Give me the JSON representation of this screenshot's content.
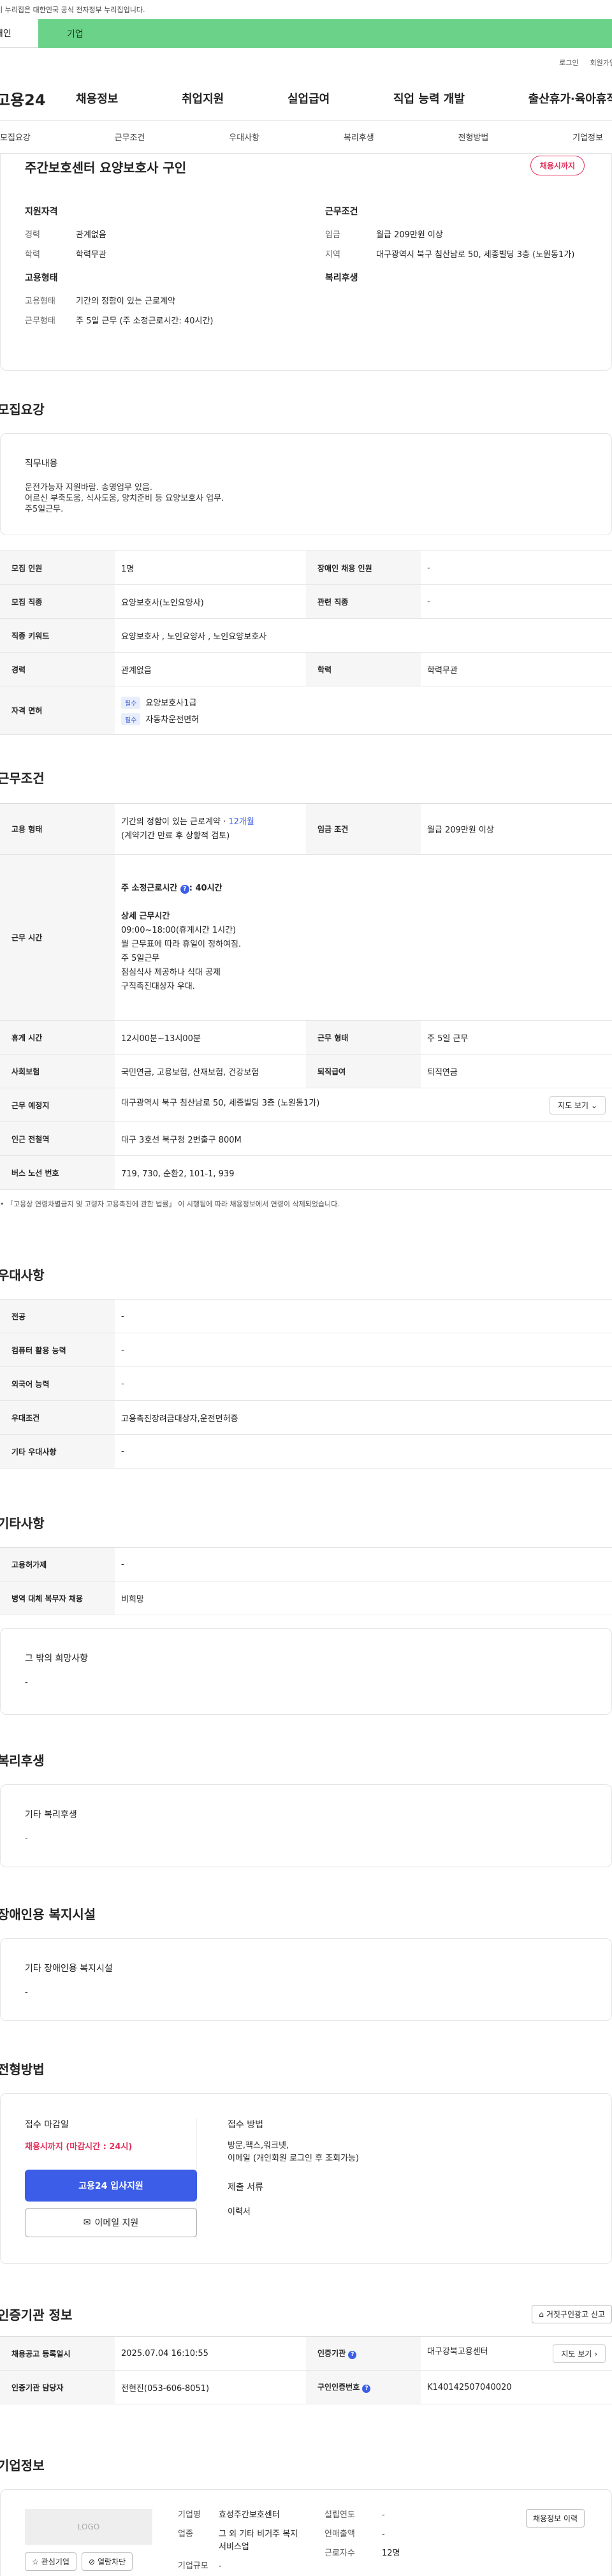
{
  "gov_bar": {
    "text": "이 누리집은 대한민국 공식 전자정부 누리집입니다."
  },
  "tabs": {
    "person": "개인",
    "business": "기업"
  },
  "util": {
    "login": "로그인",
    "join": "회원가입"
  },
  "gnb": {
    "logo": "고용24",
    "menu": [
      "채용정보",
      "취업지원",
      "실업급여",
      "직업 능력 개발",
      "출산휴가·육아휴직"
    ]
  },
  "subnav": [
    "모집요강",
    "근무조건",
    "우대사항",
    "복리후생",
    "전형방법",
    "기업정보"
  ],
  "summary": {
    "title": "주간보호센터 요양보호사 구인",
    "status": "채용시까지",
    "qualification_title": "지원자격",
    "qualification": [
      {
        "k": "경력",
        "v": "관계없음"
      },
      {
        "k": "학력",
        "v": "학력무관"
      }
    ],
    "condition_title": "근무조건",
    "condition": [
      {
        "k": "임금",
        "v": "월급 209만원 이상"
      },
      {
        "k": "지역",
        "v": "대구광역시 북구 침산남로 50, 세종빌딩 3층 (노원동1가)"
      }
    ],
    "employment_title": "고용형태",
    "employment": [
      {
        "k": "고용형태",
        "v": "기간의 정함이 있는 근로계약"
      },
      {
        "k": "근무형태",
        "v": "주 5일 근무 (주 소정근로시간: 40시간)"
      }
    ],
    "welfare_title": "복리후생"
  },
  "recruit": {
    "section_title": "모집요강",
    "job_desc_title": "직무내용",
    "job_desc": [
      "운전가능자 지원바람. 송영업무 있음.",
      "어르신 부축도움, 식사도움, 양치준비 등 요양보호사 업무.",
      "주5일근무."
    ],
    "table": {
      "headcount_label": "모집 인원",
      "headcount": "1명",
      "disabled_label": "장애인 채용 인원",
      "disabled": "-",
      "job_label": "모집 직종",
      "job": "요양보호사(노인요양사)",
      "related_label": "관련 직종",
      "related": "-",
      "keyword_label": "직종 키워드",
      "keyword": "요양보호사 , 노인요양사 , 노인요양보호사",
      "career_label": "경력",
      "career": "관계없음",
      "edu_label": "학력",
      "edu": "학력무관",
      "license_label": "자격 면허",
      "licenses": [
        {
          "tag": "필수",
          "name": "요양보호사1급"
        },
        {
          "tag": "필수",
          "name": "자동차운전면허"
        }
      ]
    }
  },
  "conditions": {
    "section_title": "근무조건",
    "emp_type_label": "고용 형태",
    "emp_type_1": "기간의 정함이 있는 근로계약 · ",
    "emp_type_months": "12개월",
    "emp_type_2": "(계약기간 만료 후 상황적 검토)",
    "wage_label": "임금 조건",
    "wage": "월급 209만원 이상",
    "hours_label": "근무 시간",
    "hours_weekly": "주 소정근로시간",
    "hours_weekly_value": ": 40시간",
    "hours_detail_title": "상세 근무시간",
    "hours_detail": [
      "09:00~18:00(휴게시간 1시간)",
      "월 근무표에 따라 휴일이 정하여짐.",
      "주 5일근무",
      "점심식사 제공하나  식대 공제",
      "구직촉진대상자 우대."
    ],
    "break_label": "휴게 시간",
    "break": "12시00분~13시00분",
    "work_type_label": "근무 형태",
    "work_type": "주 5일 근무",
    "insurance_label": "사회보험",
    "insurance": "국민연금, 고용보험, 산재보험, 건강보험",
    "severance_label": "퇴직급여",
    "severance": "퇴직연금",
    "place_label": "근무 예정지",
    "place": "대구광역시 북구 침산남로 50, 세종빌딩 3층 (노원동1가)",
    "map_btn": "지도 보기",
    "subway_label": "인근 전철역",
    "subway": "대구 3호선 북구청 2번출구 800M",
    "bus_label": "버스 노선 번호",
    "bus": "719, 730, 순환2, 101-1, 939",
    "note": "「고용상 연령차별금지 및 고령자 고용촉진에 관한 법률」 이 시행됨에 따라 채용정보에서 연령이 삭제되었습니다."
  },
  "preference": {
    "section_title": "우대사항",
    "rows": [
      {
        "k": "전공",
        "v": "-"
      },
      {
        "k": "컴퓨터 활용 능력",
        "v": "-"
      },
      {
        "k": "외국어 능력",
        "v": "-"
      },
      {
        "k": "우대조건",
        "v": "고용촉진장려금대상자,운전면허증"
      },
      {
        "k": "기타 우대사항",
        "v": "-"
      }
    ]
  },
  "etc": {
    "section_title": "기타사항",
    "rows": [
      {
        "k": "고용허가제",
        "v": "-"
      },
      {
        "k": "병역 대체 복무자 채용",
        "v": "비희망"
      }
    ],
    "other_title": "그 밖의 희망사항",
    "other_value": "-"
  },
  "welfare": {
    "section_title": "복리후생",
    "card_title": "기타 복리후생",
    "card_value": "-"
  },
  "disabled_facility": {
    "section_title": "장애인용 복지시설",
    "card_title": "기타 장애인용 복지시설",
    "card_value": "-"
  },
  "selection": {
    "section_title": "전형방법",
    "deadline_title": "접수 마감일",
    "deadline_value": "채용시까지 (마감시간 : 24시)",
    "apply_btn": "고용24 입사지원",
    "email_btn": "이메일 지원",
    "method_title": "접수 방법",
    "method_lines": [
      "방문,팩스,워크넷,",
      "이메일 (개인회원 로그인 후 조회가능)"
    ],
    "docs_title": "제출 서류",
    "docs_value": "이력서"
  },
  "cert": {
    "section_title": "인증기관 정보",
    "report_btn": "거짓구인광고 신고",
    "reg_label": "채용공고 등록일시",
    "reg_value": "2025.07.04 16:10:55",
    "agency_label": "인증기관",
    "agency_value": "대구강북고용센터",
    "agency_btn": "지도 보기",
    "manager_label": "인증기관 담당자",
    "manager_value": "전현진(053-606-8051)",
    "auth_no_label": "구인인증번호",
    "auth_no_value": "K140142507040020"
  },
  "company": {
    "section_title": "기업정보",
    "logo_text": "LOGO",
    "fav_btn": "관심기업",
    "block_btn": "열람차단",
    "name_label": "기업명",
    "name": "효성주간보호센터",
    "industry_label": "업종",
    "industry": "그 외 기타 비거주 복지 서비스업",
    "size_label": "기업규모",
    "size": "-",
    "founded_label": "설립연도",
    "founded": "-",
    "revenue_label": "연매출액",
    "revenue": "-",
    "employees_label": "근로자수",
    "employees": "12명",
    "history_btn": "채용정보 이력"
  }
}
